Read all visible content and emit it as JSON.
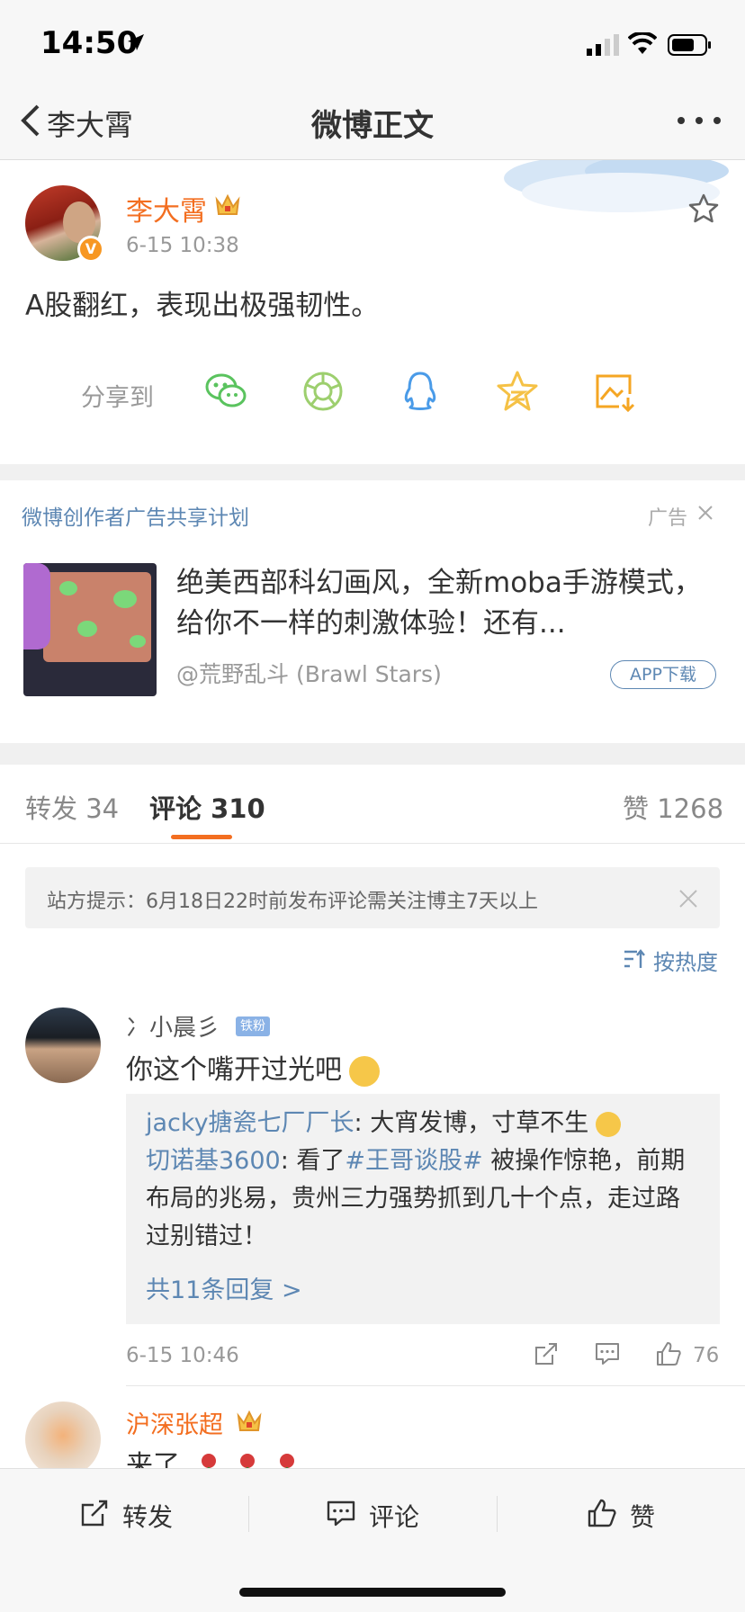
{
  "status": {
    "time": "14:50"
  },
  "nav": {
    "back_label": "李大霄",
    "title": "微博正文"
  },
  "post": {
    "author": "李大霄",
    "time": "6-15 10:38",
    "text": "A股翻红，表现出极强韧性。",
    "share_label": "分享到",
    "share_icons": [
      "wechat-icon",
      "moments-icon",
      "qq-icon",
      "qzone-icon",
      "save-image-icon"
    ]
  },
  "ad": {
    "plan": "微博创作者广告共享计划",
    "tag": "广告",
    "title": "绝美西部科幻画风，全新moba手游模式，给你不一样的刺激体验！还有...",
    "source": "@荒野乱斗 (Brawl Stars)",
    "button": "APP下载"
  },
  "tabs": {
    "repost_label": "转发",
    "repost_count": "34",
    "comment_label": "评论",
    "comment_count": "310",
    "like_label": "赞",
    "like_count": "1268"
  },
  "notice": {
    "text": "站方提示：6月18日22时前发布评论需关注博主7天以上"
  },
  "sort": {
    "label": "按热度"
  },
  "comments": [
    {
      "name": "冫小晨彡",
      "badge": "铁粉",
      "text": "你这个嘴开过光吧",
      "replies": [
        {
          "name": "jacky搪瓷七厂厂长",
          "text": ": 大宵发博，寸草不生"
        },
        {
          "name": "切诺基3600",
          "text_pre": ": 看了",
          "hashtag": "#王哥谈股#",
          "text_post": " 被操作惊艳，前期布局的兆易，贵州三力强势抓到几十个点，走过路过别错过！"
        }
      ],
      "more": "共11条回复 >",
      "time": "6-15 10:46",
      "likes": "76"
    },
    {
      "name": "沪深张超",
      "text": "来了"
    }
  ],
  "bottom": {
    "repost": "转发",
    "comment": "评论",
    "like": "赞"
  },
  "colors": {
    "accent": "#f36e20",
    "link": "#5d87b3"
  }
}
